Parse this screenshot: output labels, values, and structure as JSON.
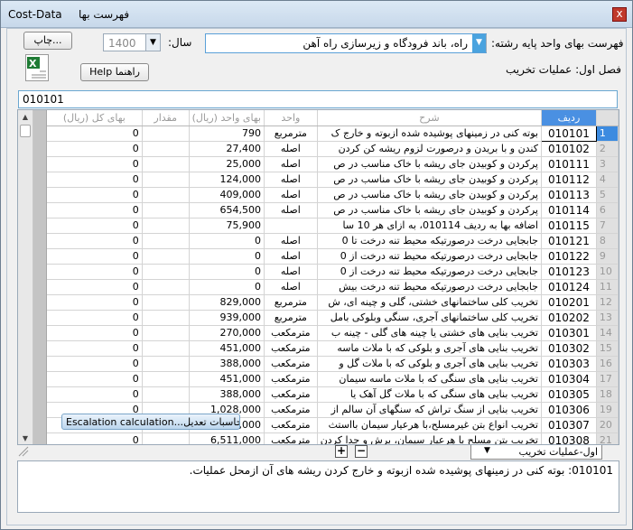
{
  "window": {
    "app_title": "Cost-Data",
    "form_title": "فهرست بها",
    "close_label": "x"
  },
  "header": {
    "list_label": "فهرست بهای واحد پایه رشته:",
    "field_value": "راه، باند فرودگاه و زیرسازی راه آهن",
    "year_label": "سال:",
    "year_value": "1400",
    "print_label": "چاپ...",
    "help_label": "Help  راهنما",
    "chapter": "فصل اول: عملیات تخریب"
  },
  "search": {
    "value": "010101"
  },
  "grid": {
    "headers": {
      "code": "ردیف",
      "desc": "شرح",
      "unit": "واحد",
      "unit_price": "بهای واحد (ریال)",
      "qty": "مقدار",
      "total": "بهای کل (ریال)"
    },
    "rows": [
      {
        "idx": "1",
        "code": "010101",
        "desc": "بوته کنی در زمینهای پوشیده شده ازبوته و خارج ک",
        "unit": "مترمربع",
        "price": "790",
        "qty": "",
        "total": "0"
      },
      {
        "idx": "2",
        "code": "010102",
        "desc": "کندن و با بریدن و درصورت لزوم ریشه کن کردن",
        "unit": "اصله",
        "price": "27,400",
        "qty": "",
        "total": "0"
      },
      {
        "idx": "3",
        "code": "010111",
        "desc": "پرکردن و کوبیدن جای ریشه با خاک مناسب در ص",
        "unit": "اصله",
        "price": "25,000",
        "qty": "",
        "total": "0"
      },
      {
        "idx": "4",
        "code": "010112",
        "desc": "پرکردن و کوبیدن جای ریشه با خاک مناسب در ص",
        "unit": "اصله",
        "price": "124,000",
        "qty": "",
        "total": "0"
      },
      {
        "idx": "5",
        "code": "010113",
        "desc": "پرکردن و کوبیدن جای ریشه با خاک مناسب در ص",
        "unit": "اصله",
        "price": "409,000",
        "qty": "",
        "total": "0"
      },
      {
        "idx": "6",
        "code": "010114",
        "desc": "پرکردن و کوبیدن جای ریشه با خاک مناسب در ص",
        "unit": "اصله",
        "price": "654,500",
        "qty": "",
        "total": "0"
      },
      {
        "idx": "7",
        "code": "010115",
        "desc": "اضافه بها به ردیف 010114، به ازای هر 10 سا",
        "unit": "",
        "price": "75,900",
        "qty": "",
        "total": "0"
      },
      {
        "idx": "8",
        "code": "010121",
        "desc": "جابجایی درخت درصورتیکه محیط تنه درخت تا 0",
        "unit": "اصله",
        "price": "0",
        "qty": "",
        "total": "0"
      },
      {
        "idx": "9",
        "code": "010122",
        "desc": "جابجایی درخت درصورتیکه محیط تنه درخت از 0",
        "unit": "اصله",
        "price": "0",
        "qty": "",
        "total": "0"
      },
      {
        "idx": "10",
        "code": "010123",
        "desc": "جابجایی درخت درصورتیکه محیط تنه درخت از 0",
        "unit": "اصله",
        "price": "0",
        "qty": "",
        "total": "0"
      },
      {
        "idx": "11",
        "code": "010124",
        "desc": "جابجایی درخت درصورتیکه محیط تنه درخت بیش",
        "unit": "اصله",
        "price": "0",
        "qty": "",
        "total": "0"
      },
      {
        "idx": "12",
        "code": "010201",
        "desc": "تخریب کلی ساختمانهای خشتی، گلی و چینه ای، ش",
        "unit": "مترمربع",
        "price": "829,000",
        "qty": "",
        "total": "0"
      },
      {
        "idx": "13",
        "code": "010202",
        "desc": "تخریب کلی ساختمانهای آجری، سنگی وبلوکی بامل",
        "unit": "مترمربع",
        "price": "939,000",
        "qty": "",
        "total": "0"
      },
      {
        "idx": "14",
        "code": "010301",
        "desc": "تخریب بنایی های خشتی یا چینه های گلی - چینه ب",
        "unit": "مترمکعب",
        "price": "270,000",
        "qty": "",
        "total": "0"
      },
      {
        "idx": "15",
        "code": "010302",
        "desc": "تخریب بنایی های آجری و بلوکی که با ملات ماسه",
        "unit": "مترمکعب",
        "price": "451,000",
        "qty": "",
        "total": "0"
      },
      {
        "idx": "16",
        "code": "010303",
        "desc": "تخریب بنایی های آجری و بلوکی که با ملات گل و",
        "unit": "مترمکعب",
        "price": "388,000",
        "qty": "",
        "total": "0"
      },
      {
        "idx": "17",
        "code": "010304",
        "desc": "تخریب بنایی های سنگی که با ملات ماسه سیمان",
        "unit": "مترمکعب",
        "price": "451,000",
        "qty": "",
        "total": "0"
      },
      {
        "idx": "18",
        "code": "010305",
        "desc": "تخریب بنایی های سنگی که با ملات گل آهک یا",
        "unit": "مترمکعب",
        "price": "388,000",
        "qty": "",
        "total": "0"
      },
      {
        "idx": "19",
        "code": "010306",
        "desc": "تخریب بنایی از سنگ تراش که سنگهای آن سالم از",
        "unit": "مترمکعب",
        "price": "1,028,000",
        "qty": "",
        "total": "0"
      },
      {
        "idx": "20",
        "code": "010307",
        "desc": "تخریب انواع بتن غیرمسلح،با هرعیار سیمان بااستث",
        "unit": "مترمکعب",
        "price": "1,254,000",
        "qty": "",
        "total": "0"
      },
      {
        "idx": "21",
        "code": "010308",
        "desc": "تخریب بتن مسلح با هرعیار سیمان، برش و جدا کردن",
        "unit": "مترمکعب",
        "price": "6,511,000",
        "qty": "",
        "total": "0"
      }
    ]
  },
  "escalation_label": "Escalation calculation...محاسبات تعدیل",
  "plus_label": "+",
  "minus_label": "−",
  "tab_label": "اول-عملیات تخریب",
  "memo_text": "010101: بوته کنی در زمینهای پوشیده شده ازبوته و خارج کردن ریشه های آن ازمحل عملیات."
}
